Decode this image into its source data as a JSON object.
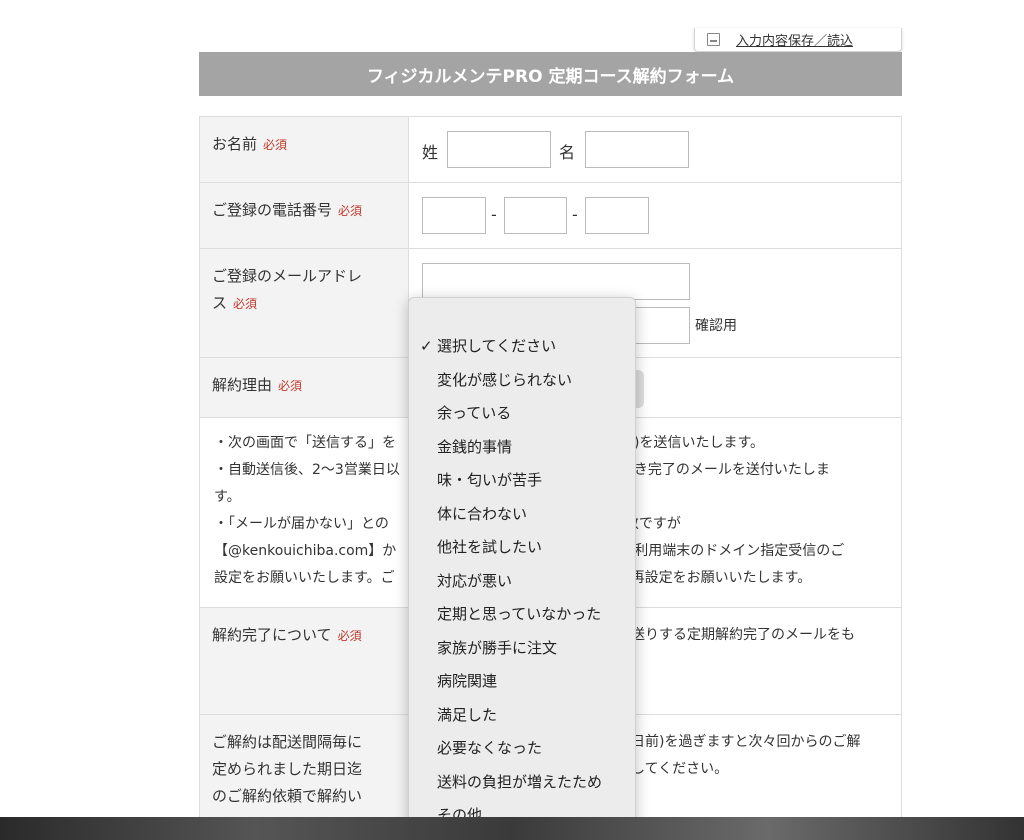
{
  "save_tab": {
    "label": "入力内容保存／読込"
  },
  "form": {
    "title": "フィジカルメンテPRO 定期コース解約フォーム",
    "required": "必須",
    "name": {
      "label": "お名前",
      "last": "姓",
      "first": "名"
    },
    "phone": {
      "label": "ご登録の電話番号",
      "sep": "-"
    },
    "email": {
      "label_line1": "ご登録のメールアドレ",
      "label_line2": "ス",
      "confirm": "確認用"
    },
    "reason": {
      "label": "解約理由"
    },
    "notes": [
      "・次の画面で「送信する」を",
      "動)を送信いたします。",
      "・自動送信後、2〜3営業日以",
      "手続き完了のメールを送付いたしま",
      "す。",
      "・「メールが届かない」との",
      "手数ですが",
      "【@kenkouichiba.com】か",
      "ご利用端末のドメイン指定受信のご",
      "設定をお願いいたします。ご",
      "の再設定をお願いいたします。"
    ],
    "completion": {
      "label": "解約完了について",
      "text": "送りする定期解約完了のメールをも"
    },
    "deadline": {
      "label_lines": [
        "ご解約は配送間隔毎に",
        "定められました期日迄",
        "のご解約依頼で解約い"
      ],
      "text_line1": "日前)を過ぎますと次々回からのご解",
      "text_line2": "してください。"
    }
  },
  "dropdown": {
    "selected_check": "✓",
    "options": [
      "選択してください",
      "変化が感じられない",
      "余っている",
      "金銭的事情",
      "味・匂いが苦手",
      "体に合わない",
      "他社を試したい",
      "対応が悪い",
      "定期と思っていなかった",
      "家族が勝手に注文",
      "病院関連",
      "満足した",
      "必要なくなった",
      "送料の負担が増えたため",
      "その他"
    ]
  }
}
